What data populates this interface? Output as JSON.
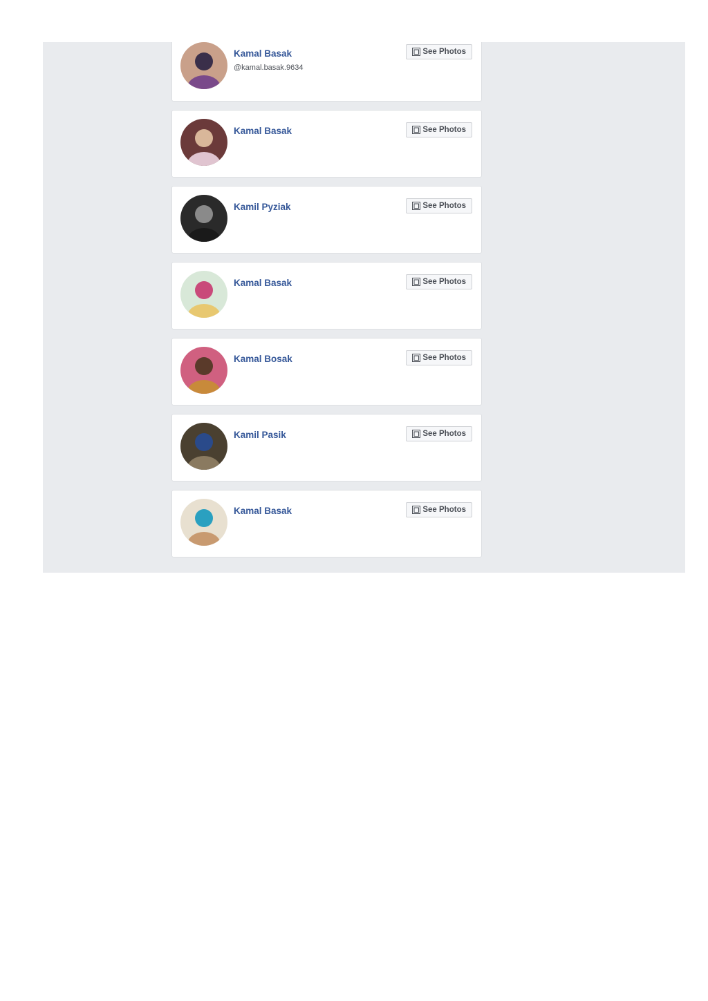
{
  "results": [
    {
      "name": "Kamal Basak",
      "handle": "@kamal.basak.9634",
      "button_label": "See Photos",
      "avatar_colors": [
        "#c9a08a",
        "#3a2f4a",
        "#7a4a8a"
      ]
    },
    {
      "name": "Kamal Basak",
      "handle": "",
      "button_label": "See Photos",
      "avatar_colors": [
        "#6b3a3a",
        "#d9b79a",
        "#e0c4d0"
      ]
    },
    {
      "name": "Kamil Pyziak",
      "handle": "",
      "button_label": "See Photos",
      "avatar_colors": [
        "#2a2a2a",
        "#8a8a8a",
        "#1a1a1a"
      ]
    },
    {
      "name": "Kamal Basak",
      "handle": "",
      "button_label": "See Photos",
      "avatar_colors": [
        "#d8e8d8",
        "#c94a7a",
        "#e8c870"
      ]
    },
    {
      "name": "Kamal Bosak",
      "handle": "",
      "button_label": "See Photos",
      "avatar_colors": [
        "#d06080",
        "#5a3a2a",
        "#c88a3a"
      ]
    },
    {
      "name": "Kamil Pasik",
      "handle": "",
      "button_label": "See Photos",
      "avatar_colors": [
        "#4a4030",
        "#2a4a8a",
        "#8a7a60"
      ]
    },
    {
      "name": "Kamal Basak",
      "handle": "",
      "button_label": "See Photos",
      "avatar_colors": [
        "#e8e0d0",
        "#2aa0c0",
        "#c89a70"
      ]
    }
  ],
  "colors": {
    "panel_background": "#e9ebee",
    "name_link": "#365899",
    "button_background": "#f6f7f9",
    "card_border": "#dddfe2"
  },
  "icons": {
    "see_photos": "photo-icon",
    "avatar": "avatar"
  }
}
